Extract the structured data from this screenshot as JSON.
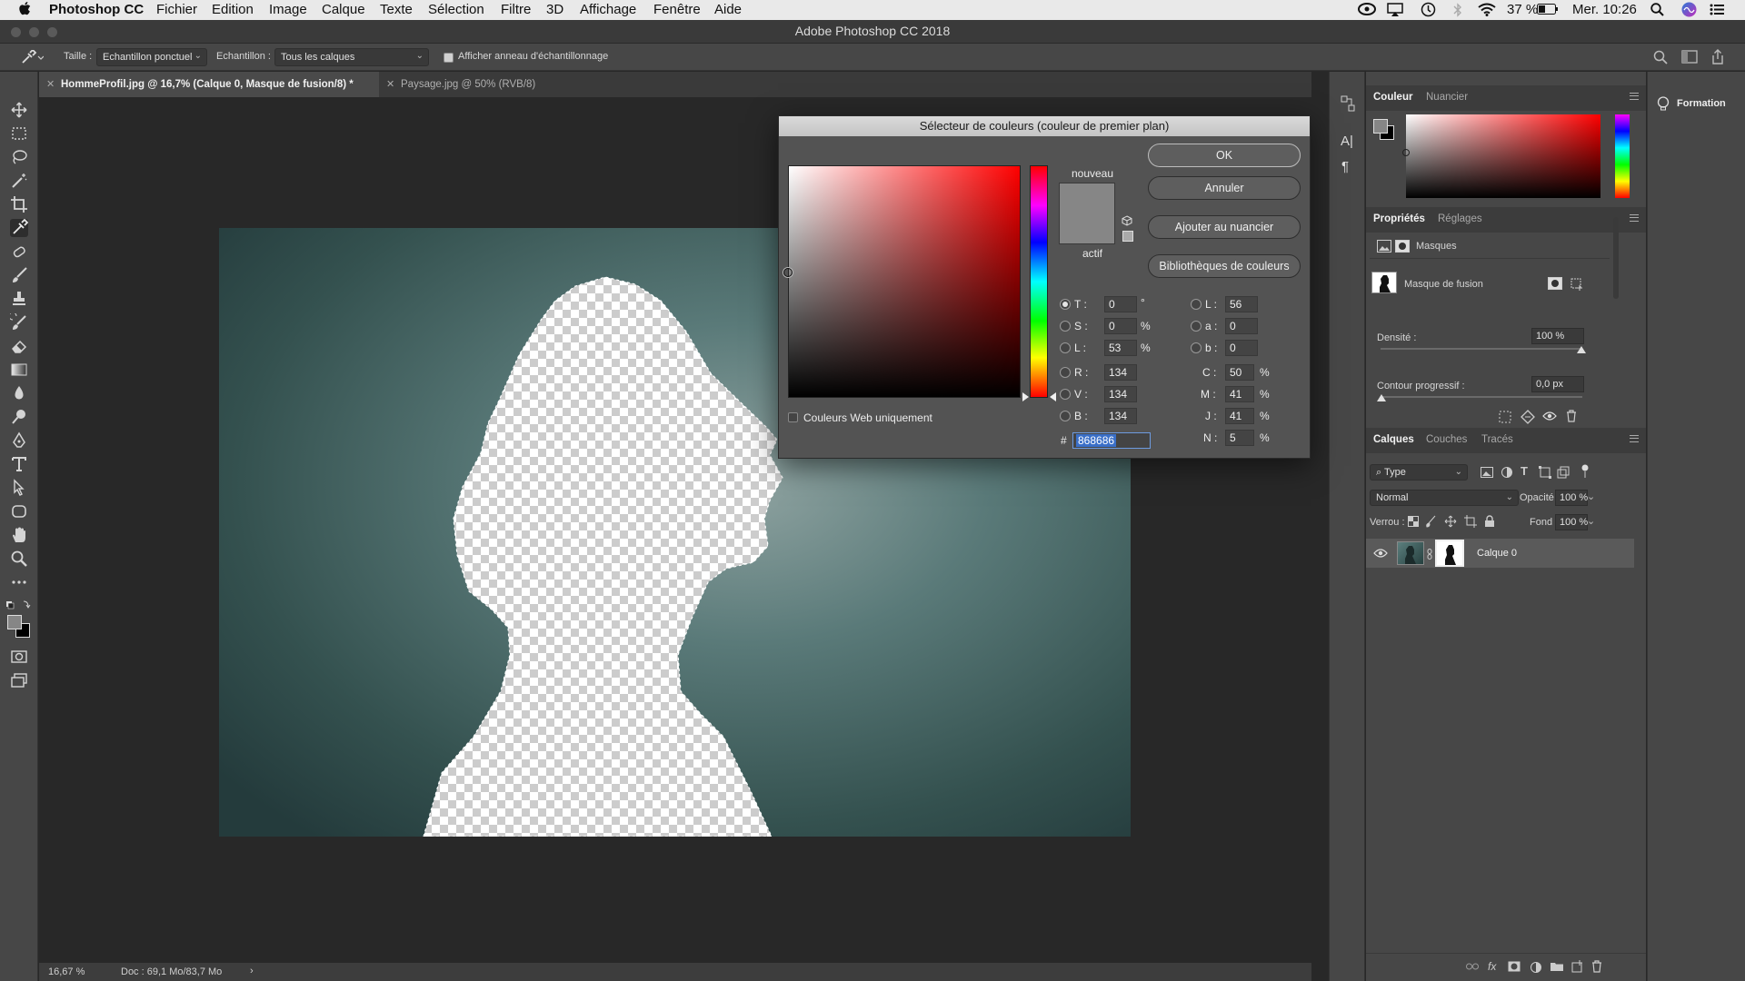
{
  "menubar": {
    "app": "Photoshop CC",
    "items": [
      "Fichier",
      "Edition",
      "Image",
      "Calque",
      "Texte",
      "Sélection",
      "Filtre",
      "3D",
      "Affichage",
      "Fenêtre",
      "Aide"
    ],
    "battery": "37 %",
    "clock": "Mer. 10:26"
  },
  "window": {
    "title": "Adobe Photoshop CC 2018"
  },
  "options": {
    "size_label": "Taille :",
    "size_value": "Echantillon ponctuel",
    "sample_label": "Echantillon :",
    "sample_value": "Tous les calques",
    "ring_label": "Afficher anneau d'échantillonnage",
    "ring_checked": true
  },
  "tabs": [
    {
      "label": "HommeProfil.jpg @ 16,7% (Calque 0, Masque de fusion/8) *",
      "active": true
    },
    {
      "label": "Paysage.jpg @ 50% (RVB/8)",
      "active": false
    }
  ],
  "status": {
    "zoom": "16,67 %",
    "doc": "Doc : 69,1 Mo/83,7 Mo"
  },
  "color_panel": {
    "tabs": [
      "Couleur",
      "Nuancier"
    ]
  },
  "properties_panel": {
    "tabs": [
      "Propriétés",
      "Réglages"
    ],
    "section": "Masques",
    "mask_label": "Masque de fusion",
    "density_label": "Densité :",
    "density_value": "100 %",
    "feather_label": "Contour progressif :",
    "feather_value": "0,0 px"
  },
  "layers_panel": {
    "tabs": [
      "Calques",
      "Couches",
      "Tracés"
    ],
    "filter": "Type",
    "blend_mode": "Normal",
    "opacity_label": "Opacité :",
    "opacity_value": "100 %",
    "lock_label": "Verrou :",
    "fill_label": "Fond :",
    "fill_value": "100 %",
    "layers": [
      {
        "name": "Calque 0"
      }
    ]
  },
  "learn": {
    "label": "Formation"
  },
  "color_picker": {
    "title": "Sélecteur de couleurs (couleur de premier plan)",
    "new_label": "nouveau",
    "current_label": "actif",
    "buttons": {
      "ok": "OK",
      "cancel": "Annuler",
      "add_swatch": "Ajouter au nuancier",
      "libraries": "Bibliothèques de couleurs"
    },
    "web_only_label": "Couleurs Web uniquement",
    "hsb": [
      {
        "label": "T :",
        "value": "0",
        "unit": "°",
        "selected": true
      },
      {
        "label": "S :",
        "value": "0",
        "unit": "%"
      },
      {
        "label": "L :",
        "value": "53",
        "unit": "%"
      }
    ],
    "rgb": [
      {
        "label": "R :",
        "value": "134"
      },
      {
        "label": "V :",
        "value": "134"
      },
      {
        "label": "B :",
        "value": "134"
      }
    ],
    "lab": [
      {
        "label": "L :",
        "value": "56"
      },
      {
        "label": "a :",
        "value": "0"
      },
      {
        "label": "b :",
        "value": "0"
      }
    ],
    "cmyk": [
      {
        "label": "C :",
        "value": "50",
        "unit": "%"
      },
      {
        "label": "M :",
        "value": "41",
        "unit": "%"
      },
      {
        "label": "J :",
        "value": "41",
        "unit": "%"
      },
      {
        "label": "N :",
        "value": "5",
        "unit": "%"
      }
    ],
    "hex_label": "#",
    "hex": "868686",
    "new_color": "#868686",
    "current_color": "#868686"
  },
  "colors": {
    "foreground": "#868686",
    "background": "#000000"
  }
}
